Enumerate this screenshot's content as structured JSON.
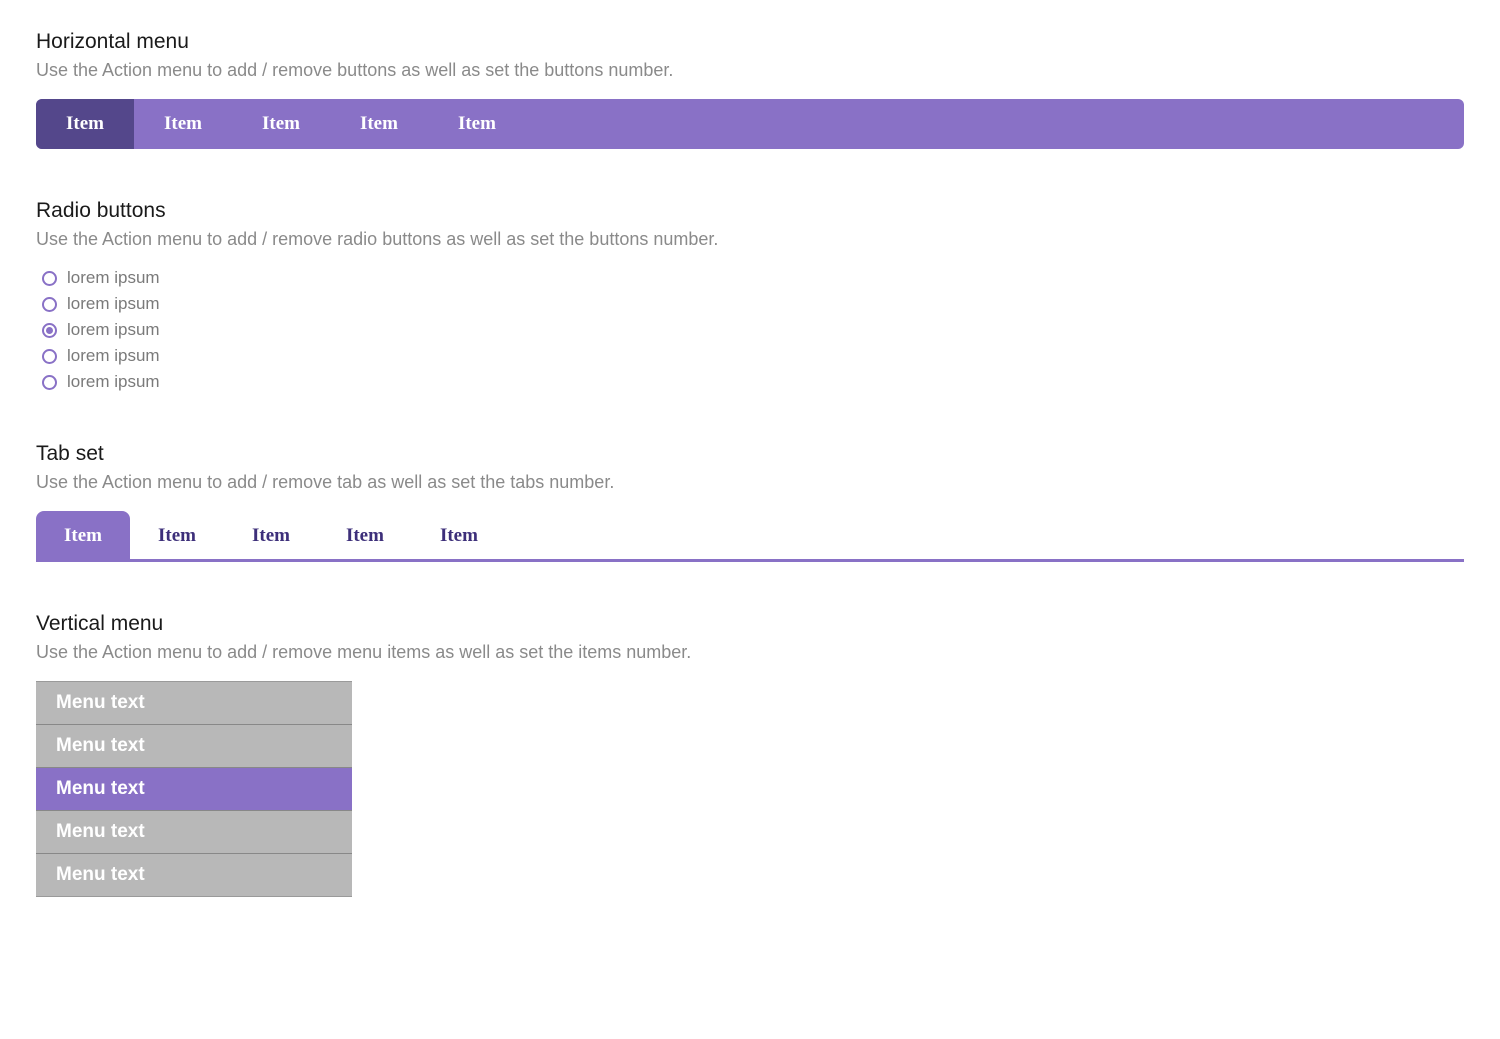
{
  "colors": {
    "accent": "#8971c6",
    "accent_dark": "#54478b",
    "grey": "#b8b8b8",
    "text_muted": "#8a8a8a"
  },
  "horizontal_menu": {
    "title": "Horizontal menu",
    "desc": "Use the Action menu to add / remove buttons as well as set the buttons number.",
    "items": [
      {
        "label": "Item",
        "active": true
      },
      {
        "label": "Item",
        "active": false
      },
      {
        "label": "Item",
        "active": false
      },
      {
        "label": "Item",
        "active": false
      },
      {
        "label": "Item",
        "active": false
      }
    ]
  },
  "radio_buttons": {
    "title": "Radio buttons",
    "desc": "Use the Action menu to add / remove radio buttons as well as set the buttons number.",
    "items": [
      {
        "label": "lorem ipsum",
        "selected": false
      },
      {
        "label": "lorem ipsum",
        "selected": false
      },
      {
        "label": "lorem ipsum",
        "selected": true
      },
      {
        "label": "lorem ipsum",
        "selected": false
      },
      {
        "label": "lorem ipsum",
        "selected": false
      }
    ]
  },
  "tab_set": {
    "title": "Tab set",
    "desc": "Use the Action menu to add / remove tab as well as set the tabs number.",
    "items": [
      {
        "label": "Item",
        "active": true
      },
      {
        "label": "Item",
        "active": false
      },
      {
        "label": "Item",
        "active": false
      },
      {
        "label": "Item",
        "active": false
      },
      {
        "label": "Item",
        "active": false
      }
    ]
  },
  "vertical_menu": {
    "title": "Vertical menu",
    "desc": "Use the Action menu to add / remove menu items as well as set the items number.",
    "items": [
      {
        "label": "Menu text",
        "active": false
      },
      {
        "label": "Menu text",
        "active": false
      },
      {
        "label": "Menu text",
        "active": true
      },
      {
        "label": "Menu text",
        "active": false
      },
      {
        "label": "Menu text",
        "active": false
      }
    ]
  }
}
